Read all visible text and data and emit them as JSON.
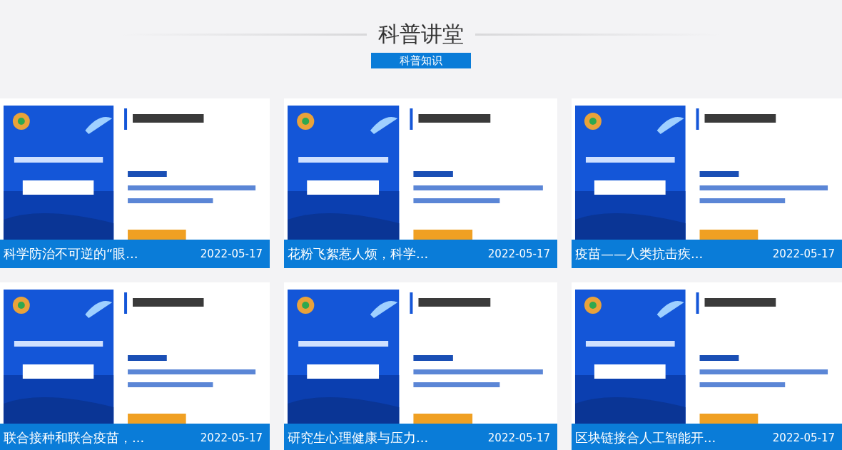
{
  "header": {
    "title": "科普讲堂",
    "subtitle": "科普知识"
  },
  "cards": [
    {
      "kind": "picture",
      "caption": "科学防治不可逆的“眼...",
      "date": "2022-05-17"
    },
    {
      "kind": "picture",
      "caption": "花粉飞絮惹人烦，科学...",
      "date": "2022-05-17"
    },
    {
      "kind": "picture",
      "caption": "疫苗——人类抗击疾...",
      "date": "2022-05-17"
    },
    {
      "kind": "picture",
      "caption": "联合接种和联合疫苗，...",
      "date": "2022-05-17"
    },
    {
      "kind": "picture",
      "caption": "研究生心理健康与压力...",
      "date": "2022-05-17"
    },
    {
      "kind": "picture",
      "caption": "区块链接合人工智能开...",
      "date": "2022-05-17"
    }
  ]
}
